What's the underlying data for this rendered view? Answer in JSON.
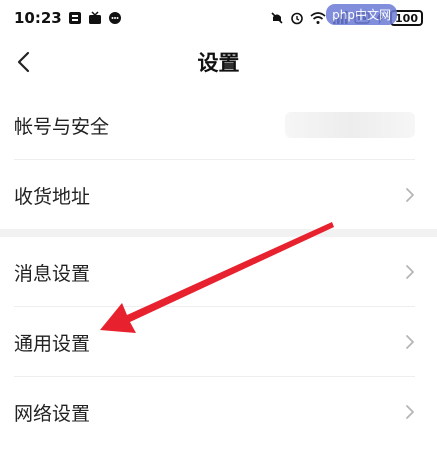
{
  "status_bar": {
    "time": "10:23",
    "battery": "100",
    "watermark": "php中文网"
  },
  "header": {
    "title": "设置"
  },
  "settings": {
    "group1": [
      {
        "label": "帐号与安全"
      },
      {
        "label": "收货地址"
      }
    ],
    "group2": [
      {
        "label": "消息设置"
      },
      {
        "label": "通用设置"
      },
      {
        "label": "网络设置"
      }
    ]
  },
  "colors": {
    "annotation_arrow": "#e8212f",
    "chevron": "#b5b5b5"
  },
  "icons": {
    "back": "chevron-left-icon",
    "row_arrow": "chevron-right-icon"
  }
}
